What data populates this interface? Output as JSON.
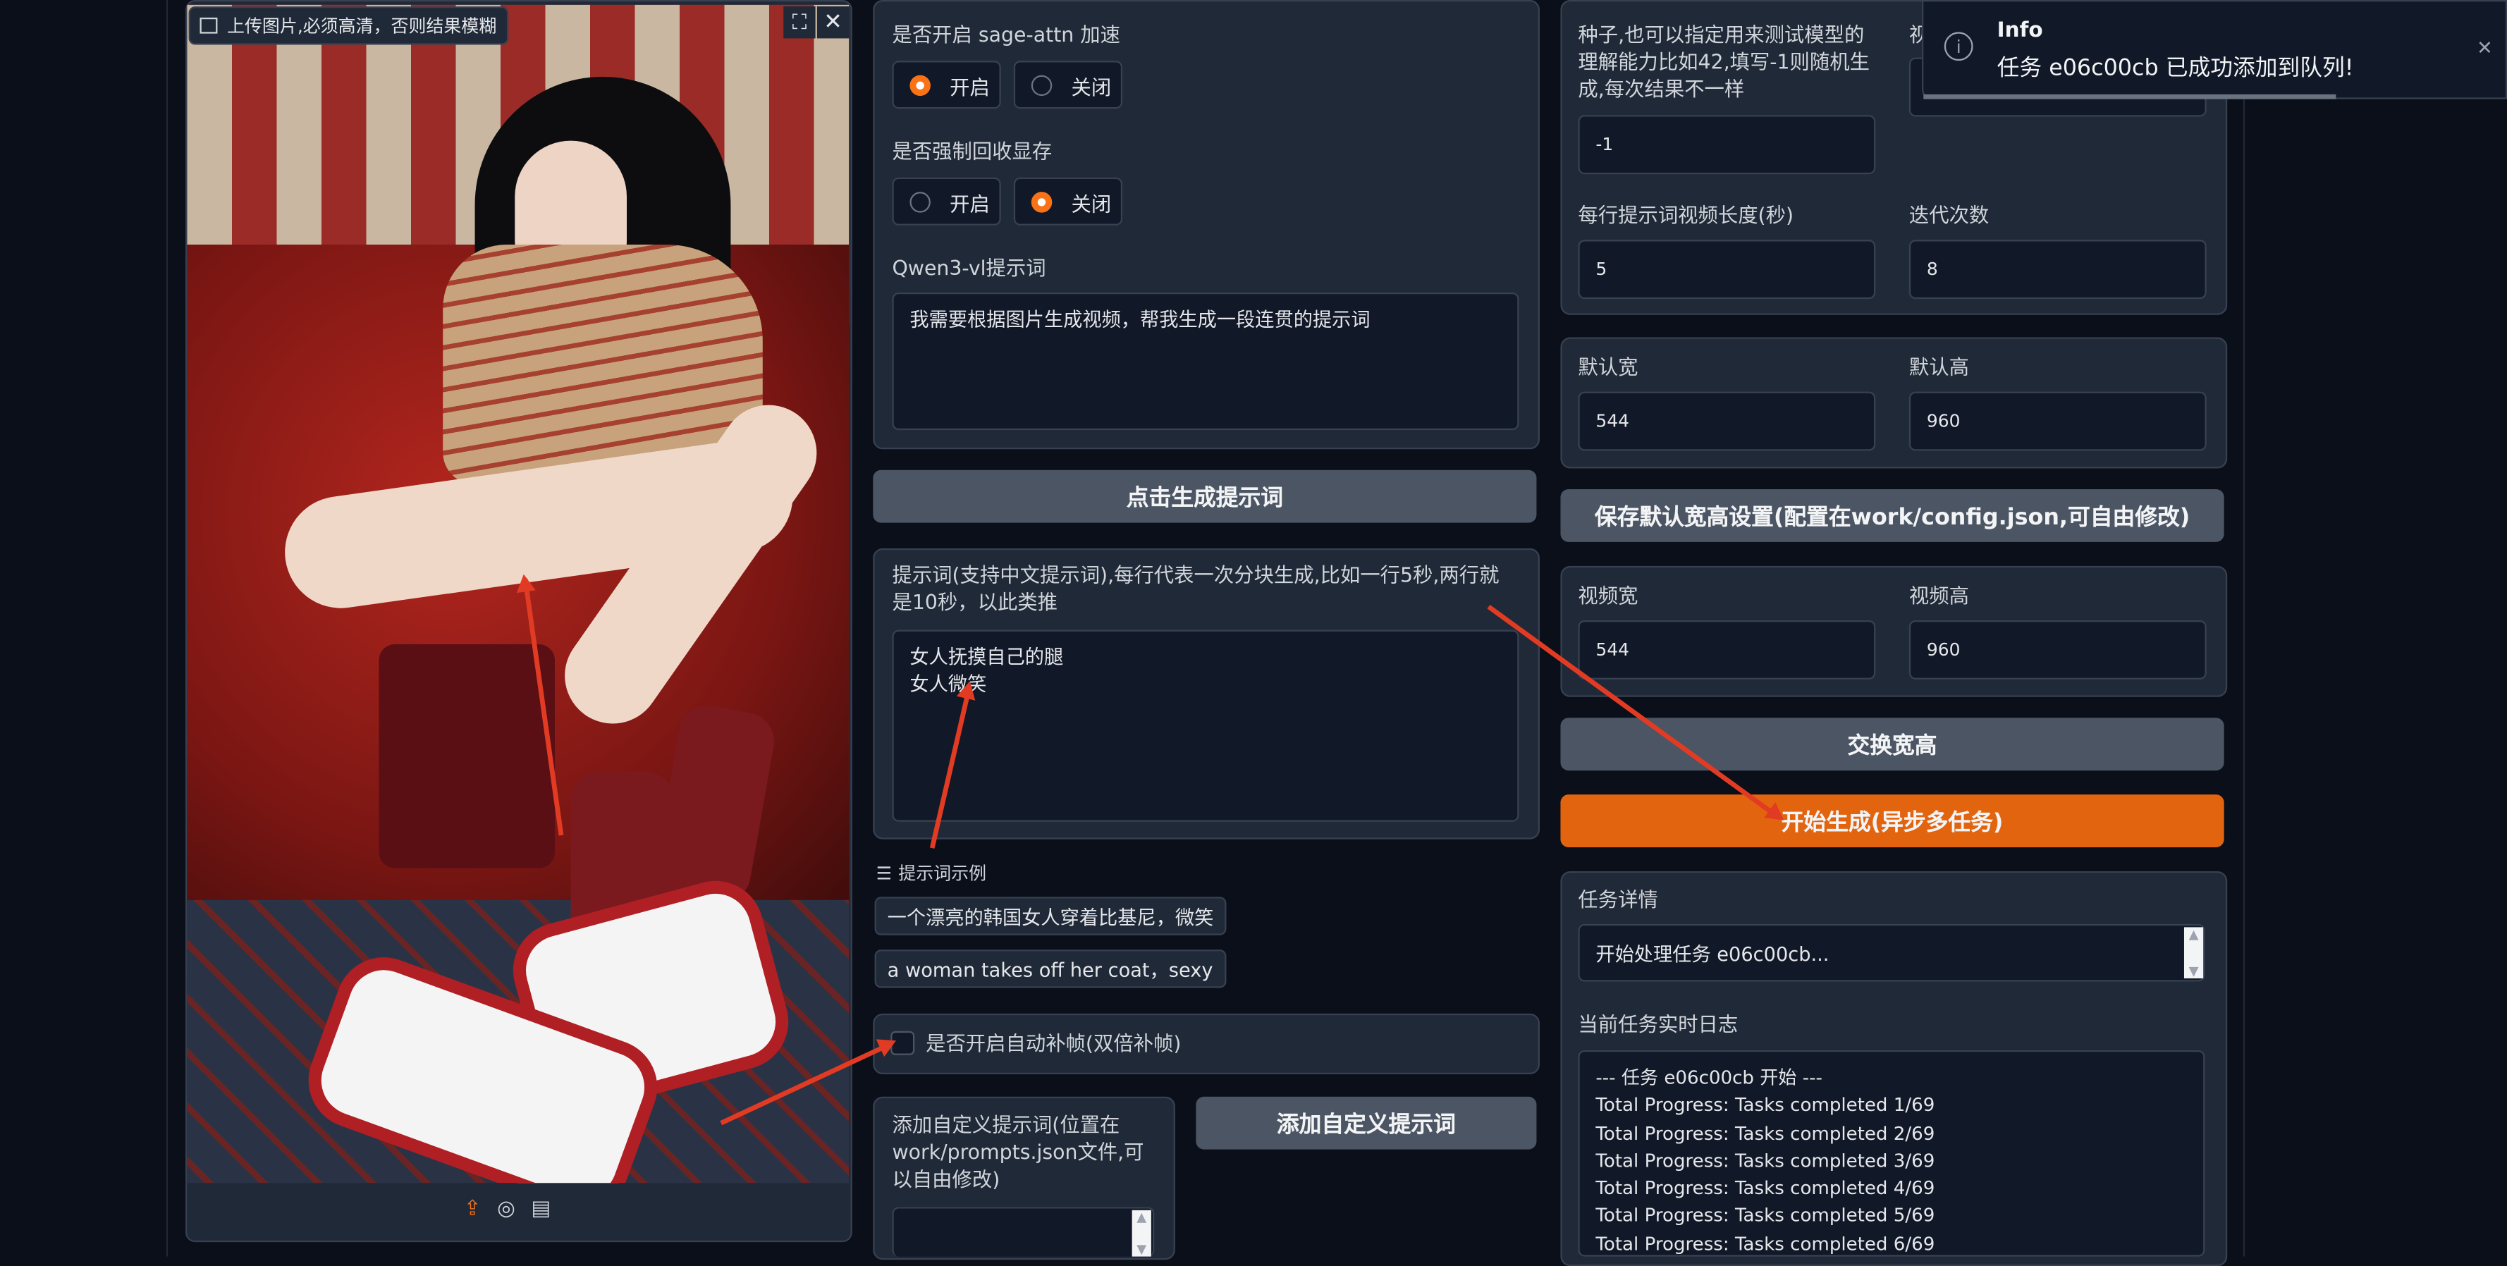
{
  "upload": {
    "badge": "上传图片,必须高清，否则结果模糊",
    "fullscreen_icon": "expand-icon",
    "close_icon": "close-icon",
    "toolbar_icons": [
      "upload-icon",
      "webcam-icon",
      "clipboard-icon"
    ]
  },
  "sage_attn": {
    "label": "是否开启 sage-attn 加速",
    "on": "开启",
    "off": "关闭",
    "selected": "开启"
  },
  "force_gc": {
    "label": "是否强制回收显存",
    "on": "开启",
    "off": "关闭",
    "selected": "关闭"
  },
  "qwen": {
    "label": "Qwen3-vl提示词",
    "value": "我需要根据图片生成视频，帮我生成一段连贯的提示词"
  },
  "gen_prompt_button": "点击生成提示词",
  "prompt": {
    "label": "提示词(支持中文提示词),每行代表一次分块生成,比如一行5秒,两行就是10秒，以此类推",
    "value": "女人抚摸自己的腿\n女人微笑"
  },
  "examples": {
    "label": "提示词示例",
    "items": [
      "一个漂亮的韩国女人穿着比基尼，微笑",
      "a woman takes off her coat，sexy"
    ]
  },
  "interp": {
    "label": "是否开启自动补帧(双倍补帧)",
    "checked": false
  },
  "custom_prompt": {
    "label": "添加自定义提示词(位置在work/prompts.json文件,可以自由修改)",
    "value": "",
    "button": "添加自定义提示词"
  },
  "seed": {
    "label": "种子,也可以指定用来测试模型的理解能力比如42,填写-1则随机生成,每次结果不一样",
    "value": "-1",
    "right_label": "视",
    "right_value": ""
  },
  "duration": {
    "label": "每行提示词视频长度(秒)",
    "value": "5"
  },
  "iterations": {
    "label": "迭代次数",
    "value": "8"
  },
  "default_size": {
    "width_label": "默认宽",
    "width": "544",
    "height_label": "默认高",
    "height": "960"
  },
  "save_default_button": "保存默认宽高设置(配置在work/config.json,可自由修改)",
  "video_size": {
    "width_label": "视频宽",
    "width": "544",
    "height_label": "视频高",
    "height": "960"
  },
  "swap_button": "交换宽高",
  "start_button": "开始生成(异步多任务)",
  "task": {
    "label": "任务详情",
    "value": "开始处理任务 e06c00cb..."
  },
  "log": {
    "label": "当前任务实时日志",
    "lines": [
      "--- 任务 e06c00cb 开始 ---",
      "Total Progress: Tasks completed 1/69",
      "Total Progress: Tasks completed 2/69",
      "Total Progress: Tasks completed 3/69",
      "Total Progress: Tasks completed 4/69",
      "Total Progress: Tasks completed 5/69",
      "Total Progress: Tasks completed 6/69"
    ]
  },
  "toast": {
    "title": "Info",
    "message": "任务 e06c00cb 已成功添加到队列!",
    "icon": "info-icon",
    "close_icon": "close-icon"
  },
  "colors": {
    "accent": "#f97316",
    "primary_button": "#e2640f",
    "annotation_arrow": "#e23b24",
    "panel": "#1f2937",
    "background": "#0b0f19"
  }
}
